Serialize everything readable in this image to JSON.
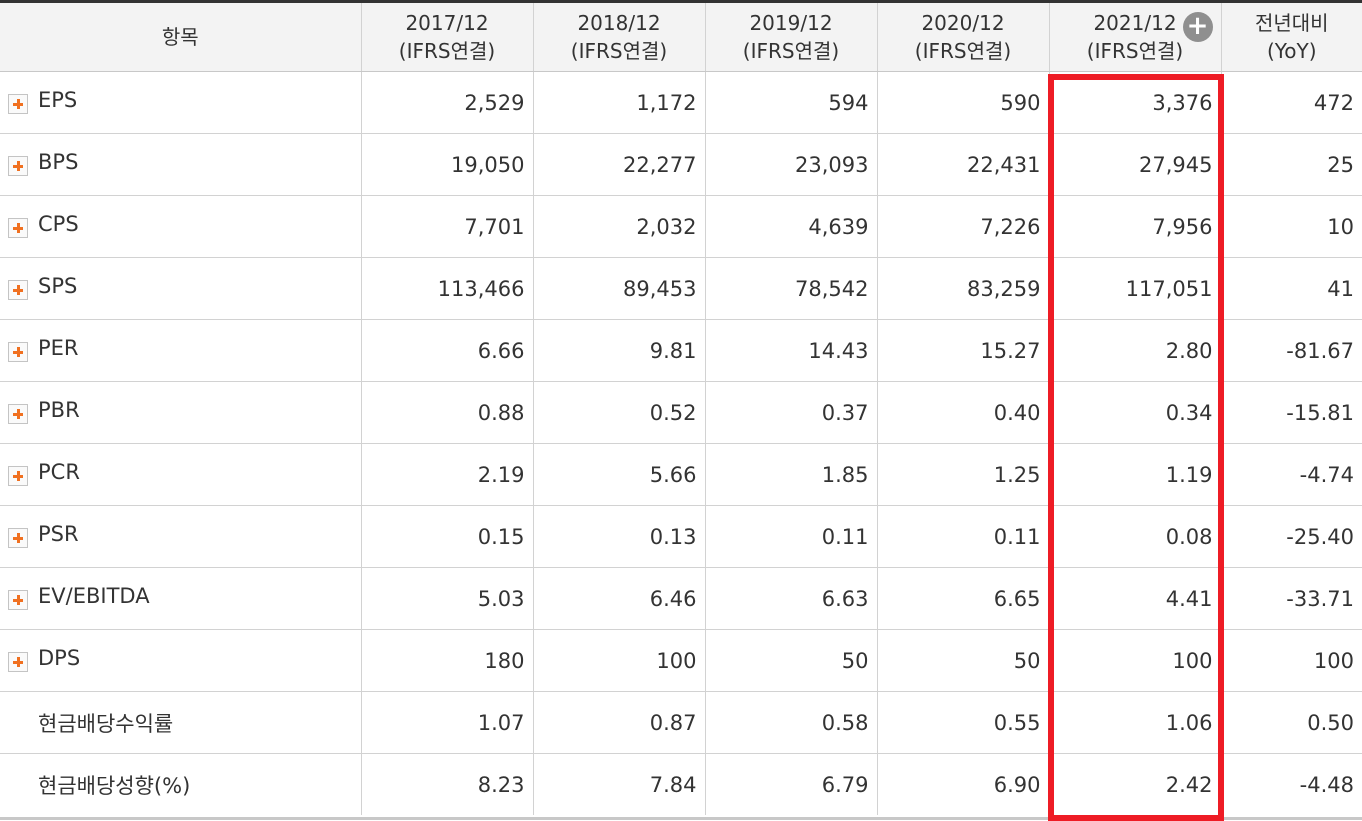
{
  "columns": [
    {
      "line1": "항목",
      "line2": ""
    },
    {
      "line1": "2017/12",
      "line2": "(IFRS연결)"
    },
    {
      "line1": "2018/12",
      "line2": "(IFRS연결)"
    },
    {
      "line1": "2019/12",
      "line2": "(IFRS연결)"
    },
    {
      "line1": "2020/12",
      "line2": "(IFRS연결)"
    },
    {
      "line1": "2021/12",
      "line2": "(IFRS연결)"
    },
    {
      "line1": "전년대비",
      "line2": "(YoY)"
    }
  ],
  "header_plus_icon": "+",
  "rows": [
    {
      "label": "EPS",
      "expandable": true,
      "values": [
        "2,529",
        "1,172",
        "594",
        "590",
        "3,376"
      ],
      "yoy": "472"
    },
    {
      "label": "BPS",
      "expandable": true,
      "values": [
        "19,050",
        "22,277",
        "23,093",
        "22,431",
        "27,945"
      ],
      "yoy": "25"
    },
    {
      "label": "CPS",
      "expandable": true,
      "values": [
        "7,701",
        "2,032",
        "4,639",
        "7,226",
        "7,956"
      ],
      "yoy": "10"
    },
    {
      "label": "SPS",
      "expandable": true,
      "values": [
        "113,466",
        "89,453",
        "78,542",
        "83,259",
        "117,051"
      ],
      "yoy": "41"
    },
    {
      "label": "PER",
      "expandable": true,
      "values": [
        "6.66",
        "9.81",
        "14.43",
        "15.27",
        "2.80"
      ],
      "yoy": "-81.67"
    },
    {
      "label": "PBR",
      "expandable": true,
      "values": [
        "0.88",
        "0.52",
        "0.37",
        "0.40",
        "0.34"
      ],
      "yoy": "-15.81"
    },
    {
      "label": "PCR",
      "expandable": true,
      "values": [
        "2.19",
        "5.66",
        "1.85",
        "1.25",
        "1.19"
      ],
      "yoy": "-4.74"
    },
    {
      "label": "PSR",
      "expandable": true,
      "values": [
        "0.15",
        "0.13",
        "0.11",
        "0.11",
        "0.08"
      ],
      "yoy": "-25.40"
    },
    {
      "label": "EV/EBITDA",
      "expandable": true,
      "values": [
        "5.03",
        "6.46",
        "6.63",
        "6.65",
        "4.41"
      ],
      "yoy": "-33.71"
    },
    {
      "label": "DPS",
      "expandable": true,
      "values": [
        "180",
        "100",
        "50",
        "50",
        "100"
      ],
      "yoy": "100"
    },
    {
      "label": "현금배당수익률",
      "expandable": false,
      "values": [
        "1.07",
        "0.87",
        "0.58",
        "0.55",
        "1.06"
      ],
      "yoy": "0.50"
    },
    {
      "label": "현금배당성향(%)",
      "expandable": false,
      "values": [
        "8.23",
        "7.84",
        "6.79",
        "6.90",
        "2.42"
      ],
      "yoy": "-4.48"
    }
  ],
  "colors": {
    "negative": "#c00000",
    "highlight": "#ee1c25",
    "expand_icon": "#f07020",
    "header_bg": "#f3f3f3"
  },
  "highlighted_column": "2021/12"
}
